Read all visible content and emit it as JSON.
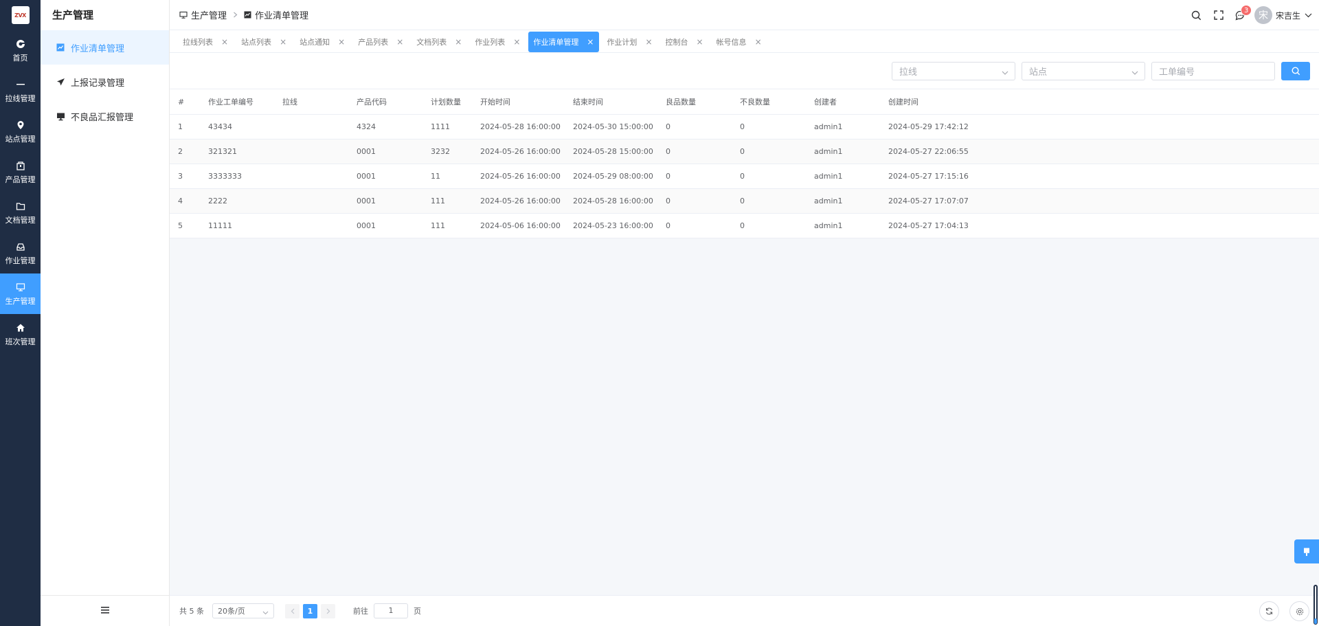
{
  "rail": {
    "logo_text": "ZVX",
    "items": [
      {
        "label": "首页",
        "icon": "chrome-icon"
      },
      {
        "label": "拉线管理",
        "icon": "minus-icon"
      },
      {
        "label": "站点管理",
        "icon": "location-icon"
      },
      {
        "label": "产品管理",
        "icon": "box-icon"
      },
      {
        "label": "文档管理",
        "icon": "folder-icon"
      },
      {
        "label": "作业管理",
        "icon": "inbox-icon"
      },
      {
        "label": "生产管理",
        "icon": "monitor-icon",
        "active": true
      },
      {
        "label": "班次管理",
        "icon": "home-icon"
      }
    ]
  },
  "submenu": {
    "title": "生产管理",
    "items": [
      {
        "label": "作业清单管理",
        "icon": "chart-icon",
        "active": true
      },
      {
        "label": "上报记录管理",
        "icon": "send-icon"
      },
      {
        "label": "不良品汇报管理",
        "icon": "monitor-icon"
      }
    ]
  },
  "header": {
    "breadcrumb": [
      "生产管理",
      "作业清单管理"
    ],
    "badge_count": "3",
    "avatar_char": "宋",
    "username": "宋吉生"
  },
  "tabs": [
    {
      "label": "拉线列表"
    },
    {
      "label": "站点列表"
    },
    {
      "label": "站点通知"
    },
    {
      "label": "产品列表"
    },
    {
      "label": "文档列表"
    },
    {
      "label": "作业列表"
    },
    {
      "label": "作业清单管理",
      "active": true
    },
    {
      "label": "作业计划"
    },
    {
      "label": "控制台"
    },
    {
      "label": "帐号信息"
    }
  ],
  "search": {
    "line_placeholder": "拉线",
    "station_placeholder": "站点",
    "order_placeholder": "工单编号"
  },
  "table": {
    "headers": [
      "#",
      "作业工单编号",
      "拉线",
      "产品代码",
      "计划数量",
      "开始时间",
      "结束时间",
      "良品数量",
      "不良数量",
      "创建者",
      "创建时间"
    ],
    "rows": [
      [
        "1",
        "43434",
        "",
        "4324",
        "1111",
        "2024-05-28 16:00:00",
        "2024-05-30 15:00:00",
        "0",
        "0",
        "admin1",
        "2024-05-29 17:42:12"
      ],
      [
        "2",
        "321321",
        "",
        "0001",
        "3232",
        "2024-05-26 16:00:00",
        "2024-05-28 15:00:00",
        "0",
        "0",
        "admin1",
        "2024-05-27 22:06:55"
      ],
      [
        "3",
        "3333333",
        "",
        "0001",
        "11",
        "2024-05-26 16:00:00",
        "2024-05-29 08:00:00",
        "0",
        "0",
        "admin1",
        "2024-05-27 17:15:16"
      ],
      [
        "4",
        "2222",
        "",
        "0001",
        "111",
        "2024-05-26 16:00:00",
        "2024-05-28 16:00:00",
        "0",
        "0",
        "admin1",
        "2024-05-27 17:07:07"
      ],
      [
        "5",
        "11111",
        "",
        "0001",
        "111",
        "2024-05-06 16:00:00",
        "2024-05-23 16:00:00",
        "0",
        "0",
        "admin1",
        "2024-05-27 17:04:13"
      ]
    ]
  },
  "pagination": {
    "total": "共 5 条",
    "page_size": "20条/页",
    "current_page": "1",
    "goto_label": "前往",
    "goto_value": "1",
    "goto_suffix": "页"
  }
}
